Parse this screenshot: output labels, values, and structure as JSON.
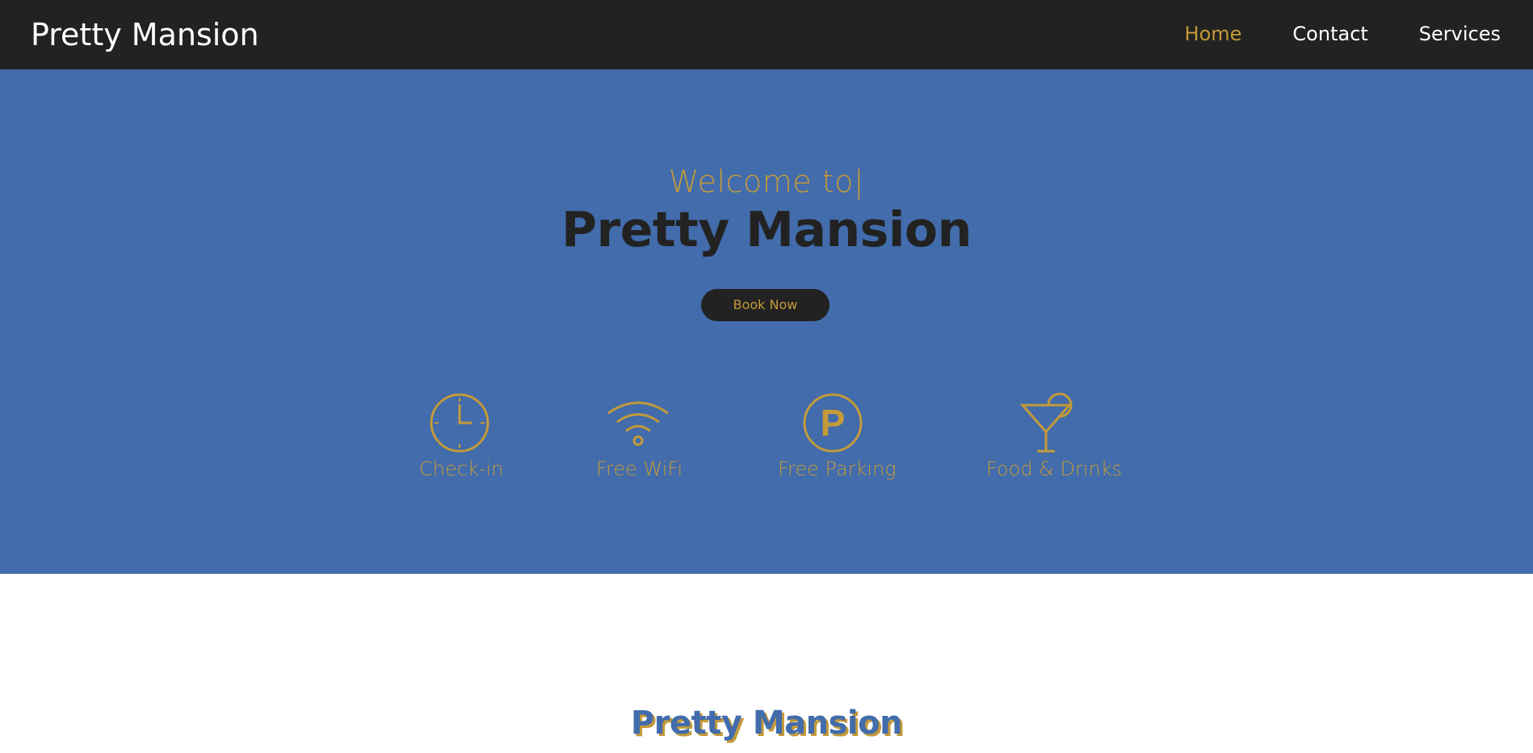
{
  "header": {
    "brand": "Pretty Mansion",
    "nav": [
      {
        "label": "Home",
        "active": true
      },
      {
        "label": "Contact",
        "active": false
      },
      {
        "label": "Services",
        "active": false
      }
    ]
  },
  "hero": {
    "welcome": "Welcome to|",
    "title": "Pretty Mansion",
    "book_button": "Book Now",
    "features": [
      {
        "icon": "clock-icon",
        "label": "Check-in"
      },
      {
        "icon": "wifi-icon",
        "label": "Free WiFi"
      },
      {
        "icon": "parking-icon",
        "label": "Free Parking"
      },
      {
        "icon": "cocktail-icon",
        "label": "Food & Drinks"
      }
    ]
  },
  "about": {
    "title": "Pretty Mansion"
  },
  "colors": {
    "nav_bg": "#222222",
    "hero_bg": "#426cab",
    "accent": "#c49a3a",
    "dark_text": "#222222"
  }
}
